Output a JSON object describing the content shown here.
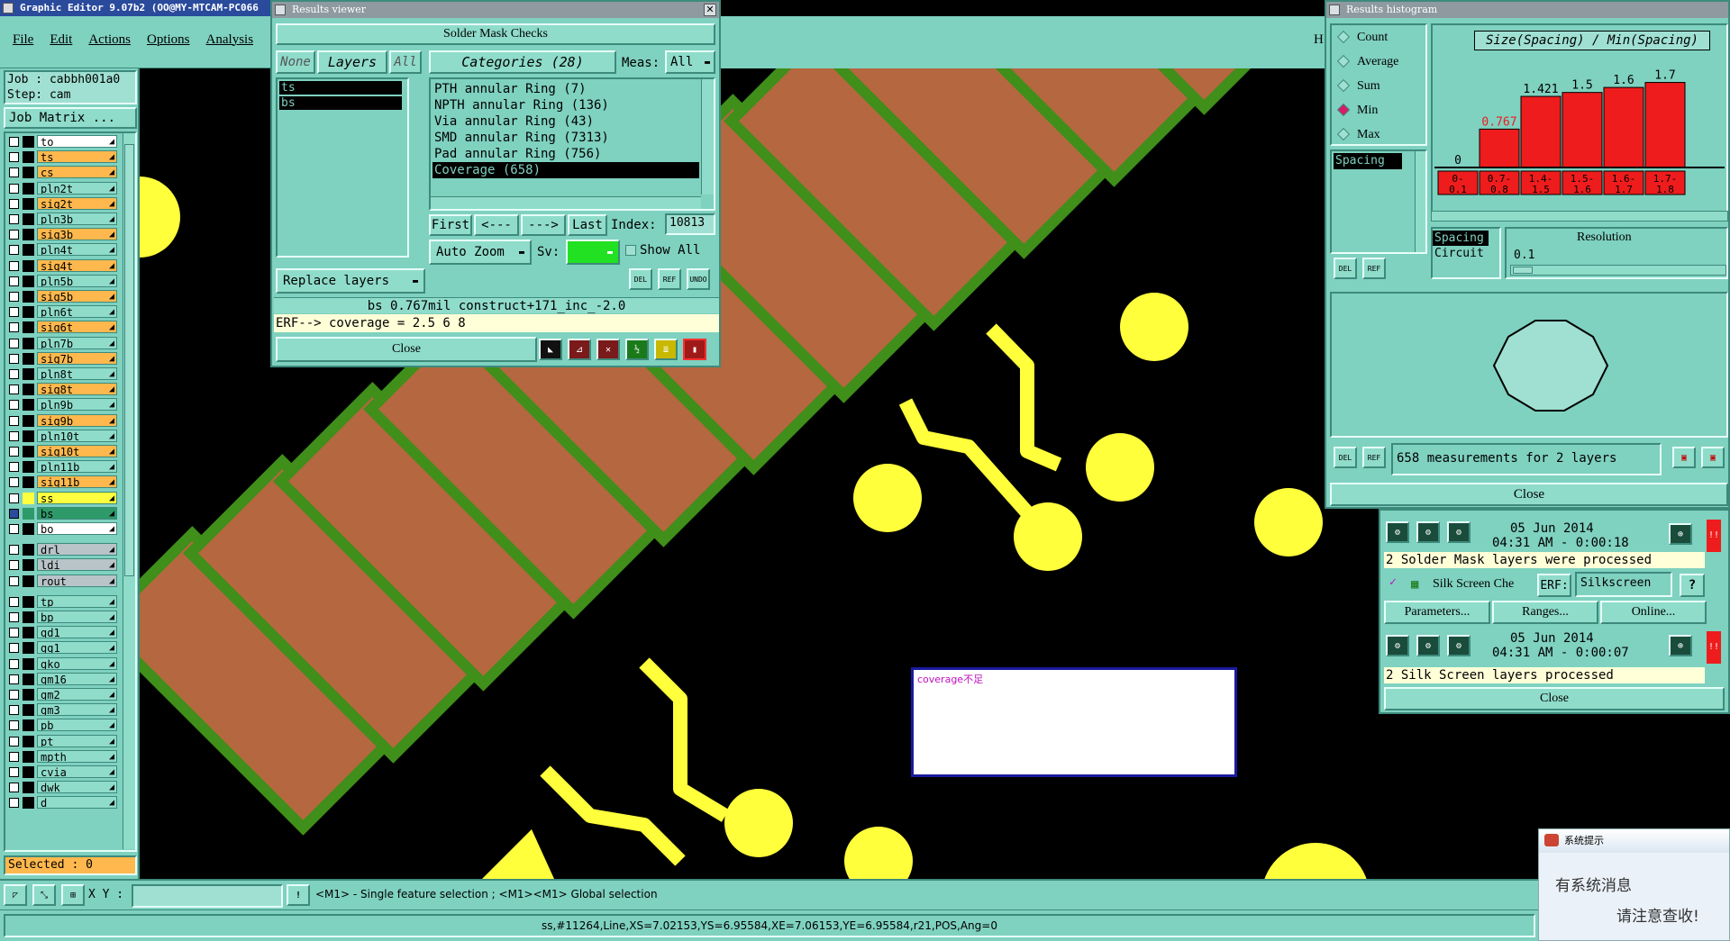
{
  "app": {
    "title": "Graphic Editor 9.07b2  (OO@MY-MTCAM-PC066",
    "menu": [
      "File",
      "Edit",
      "Actions",
      "Options",
      "Analysis"
    ],
    "menu_extra": "H"
  },
  "left_panel": {
    "job_label": "Job : cabbh001a0",
    "step_label": "Step: cam",
    "job_matrix_button": "Job Matrix ...",
    "layers": [
      {
        "name": "to",
        "color": "#ffffff"
      },
      {
        "name": "ts",
        "color": "#ffb84d"
      },
      {
        "name": "cs",
        "color": "#ffb84d"
      },
      {
        "name": "pln2t",
        "color": "#8fdcca"
      },
      {
        "name": "sig2t",
        "color": "#ffb84d"
      },
      {
        "name": "pln3b",
        "color": "#8fdcca"
      },
      {
        "name": "sig3b",
        "color": "#ffb84d"
      },
      {
        "name": "pln4t",
        "color": "#8fdcca"
      },
      {
        "name": "sig4t",
        "color": "#ffb84d"
      },
      {
        "name": "pln5b",
        "color": "#8fdcca"
      },
      {
        "name": "sig5b",
        "color": "#ffb84d"
      },
      {
        "name": "pln6t",
        "color": "#8fdcca"
      },
      {
        "name": "sig6t",
        "color": "#ffb84d"
      },
      {
        "name": "pln7b",
        "color": "#8fdcca"
      },
      {
        "name": "sig7b",
        "color": "#ffb84d"
      },
      {
        "name": "pln8t",
        "color": "#8fdcca"
      },
      {
        "name": "sig8t",
        "color": "#ffb84d"
      },
      {
        "name": "pln9b",
        "color": "#8fdcca"
      },
      {
        "name": "sig9b",
        "color": "#ffb84d"
      },
      {
        "name": "pln10t",
        "color": "#8fdcca"
      },
      {
        "name": "sig10t",
        "color": "#ffb84d"
      },
      {
        "name": "pln11b",
        "color": "#8fdcca"
      },
      {
        "name": "sig11b",
        "color": "#ffb84d"
      },
      {
        "name": "ss",
        "color": "#ffff40"
      },
      {
        "name": "bs",
        "color": "#2e9a6a"
      },
      {
        "name": "bo",
        "color": "#ffffff"
      },
      {
        "name": "drl",
        "color": "#b8c4c8"
      },
      {
        "name": "ldi",
        "color": "#b8c4c8"
      },
      {
        "name": "rout",
        "color": "#b8c4c8"
      },
      {
        "name": "tp",
        "color": "#8fdcca"
      },
      {
        "name": "bp",
        "color": "#8fdcca"
      },
      {
        "name": "gd1",
        "color": "#8fdcca"
      },
      {
        "name": "gg1",
        "color": "#8fdcca"
      },
      {
        "name": "gko",
        "color": "#8fdcca"
      },
      {
        "name": "gm16",
        "color": "#8fdcca"
      },
      {
        "name": "gm2",
        "color": "#8fdcca"
      },
      {
        "name": "gm3",
        "color": "#8fdcca"
      },
      {
        "name": "pb",
        "color": "#8fdcca"
      },
      {
        "name": "pt",
        "color": "#8fdcca"
      },
      {
        "name": "mpth",
        "color": "#8fdcca"
      },
      {
        "name": "cvia",
        "color": "#8fdcca"
      },
      {
        "name": "dwk",
        "color": "#8fdcca"
      },
      {
        "name": "d",
        "color": "#8fdcca"
      }
    ],
    "selected_label": "Selected : 0"
  },
  "results_viewer": {
    "title": "Results viewer",
    "header": "Solder Mask Checks",
    "none_button": "None",
    "layers_button": "Layers",
    "all_button": "All",
    "layers": [
      "ts",
      "bs"
    ],
    "categories_button": "Categories (28)",
    "meas_label": "Meas:",
    "meas_value": "All",
    "categories": [
      "PTH annular Ring (7)",
      "NPTH annular Ring (136)",
      "Via annular Ring (43)",
      "SMD annular Ring (7313)",
      "Pad annular Ring (756)",
      "Coverage (658)"
    ],
    "first_button": "First",
    "prev_button": "<---",
    "next_button": "--->",
    "last_button": "Last",
    "index_label": "Index:",
    "index_value": "10813",
    "auto_zoom": "Auto Zoom",
    "sv_label": "Sv:",
    "show_all": "Show All",
    "replace_layers": "Replace layers",
    "del": "DEL",
    "ref": "REF",
    "undo": "UNDO",
    "info_line": "bs 0.767mil  construct+171_inc_-2.0",
    "erf_line": "ERF--> coverage = 2.5 6 8",
    "close": "Close"
  },
  "histogram": {
    "title": "Results histogram",
    "options": [
      "Count",
      "Average",
      "Sum",
      "Min",
      "Max"
    ],
    "selected_option": "Min",
    "list_item": "Spacing",
    "chart_title": "Size(Spacing) / Min(Spacing)",
    "del": "DEL",
    "ref": "REF",
    "spacing_label": "Spacing",
    "circuit_label": "Circuit",
    "resolution_label": "Resolution",
    "resolution_value": "0.1",
    "measurements": "658 measurements for 2 layers",
    "close": "Close"
  },
  "chart_data": {
    "type": "bar",
    "categories": [
      "0-\n0.1",
      "0.7-\n0.8",
      "1.4-\n1.5",
      "1.5-\n1.6",
      "1.6-\n1.7",
      "1.7-\n1.8"
    ],
    "values": [
      0,
      0.767,
      1.421,
      1.5,
      1.6,
      1.7
    ],
    "labels": [
      "0",
      "0.767",
      "1.421",
      "1.5",
      "1.6",
      "1.7"
    ],
    "title": "Size(Spacing) / Min(Spacing)",
    "ylim": [
      0,
      1.8
    ],
    "bar_color": "#ee1c1c",
    "highlight_label_color": "#ee1c1c"
  },
  "checklist": {
    "row1_date": "05 Jun 2014",
    "row1_time": "04:31 AM - 0:00:18",
    "row1_msg": "2 Solder Mask layers were processed",
    "silk_label": "Silk Screen Che",
    "erf_label": "ERF:",
    "erf_value": "Silkscreen",
    "help": "?",
    "params_button": "Parameters...",
    "ranges_button": "Ranges...",
    "online_button": "Online...",
    "row2_date": "05 Jun 2014",
    "row2_time": "04:31 AM - 0:00:07",
    "row2_msg": "2 Silk Screen layers processed",
    "close": "Close"
  },
  "canvas": {
    "note_text": "coverage不足"
  },
  "status": {
    "xy_label": "X Y :",
    "hint": "<M1> - Single feature selection ; <M1><M1> Global selection",
    "feature_info": "ss,#11264,Line,XS=7.02153,YS=6.95584,XE=7.06153,YE=6.95584,r21,POS,Ang=0"
  },
  "notification": {
    "title": "系统提示",
    "line1": "有系统消息",
    "line2": "请注意查收!"
  },
  "colors": {
    "board_black": "#000000",
    "pad_copper": "#b5673f",
    "pad_mask": "#3f8f1a",
    "via_yellow": "#ffff3c",
    "panel_teal": "#7fd1c0"
  }
}
